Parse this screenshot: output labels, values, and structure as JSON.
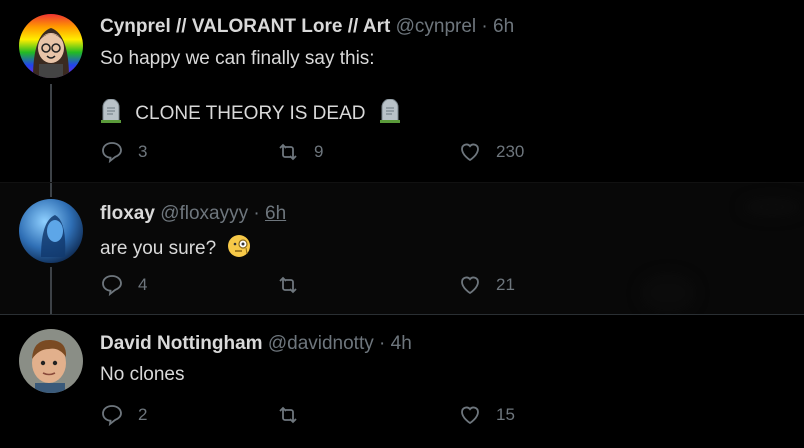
{
  "tweets": [
    {
      "name": "Cynprel // VALORANT Lore // Art",
      "handle": "@cynprel",
      "sep": "·",
      "time": "6h",
      "lines": [
        "So happy we can finally say this:",
        "CLONE THEORY IS DEAD"
      ],
      "replies": "3",
      "retweets": "9",
      "likes": "230"
    },
    {
      "name": "floxay",
      "handle": "@floxayyy",
      "sep": "·",
      "time": "6h",
      "lines": [
        "are you sure?"
      ],
      "replies": "4",
      "retweets": "",
      "likes": "21"
    },
    {
      "name": "David Nottingham",
      "handle": "@davidnotty",
      "sep": "·",
      "time": "4h",
      "lines": [
        "No clones"
      ],
      "replies": "2",
      "retweets": "",
      "likes": "15"
    }
  ],
  "icons": [
    "avatar",
    "headstone-emoji",
    "face-with-monocle-emoji",
    "reply-icon",
    "retweet-icon",
    "like-icon"
  ],
  "colors": {
    "background": "#000000",
    "text": "#d9d9d9",
    "muted": "#6e767d",
    "thread_line": "#3d4247"
  }
}
